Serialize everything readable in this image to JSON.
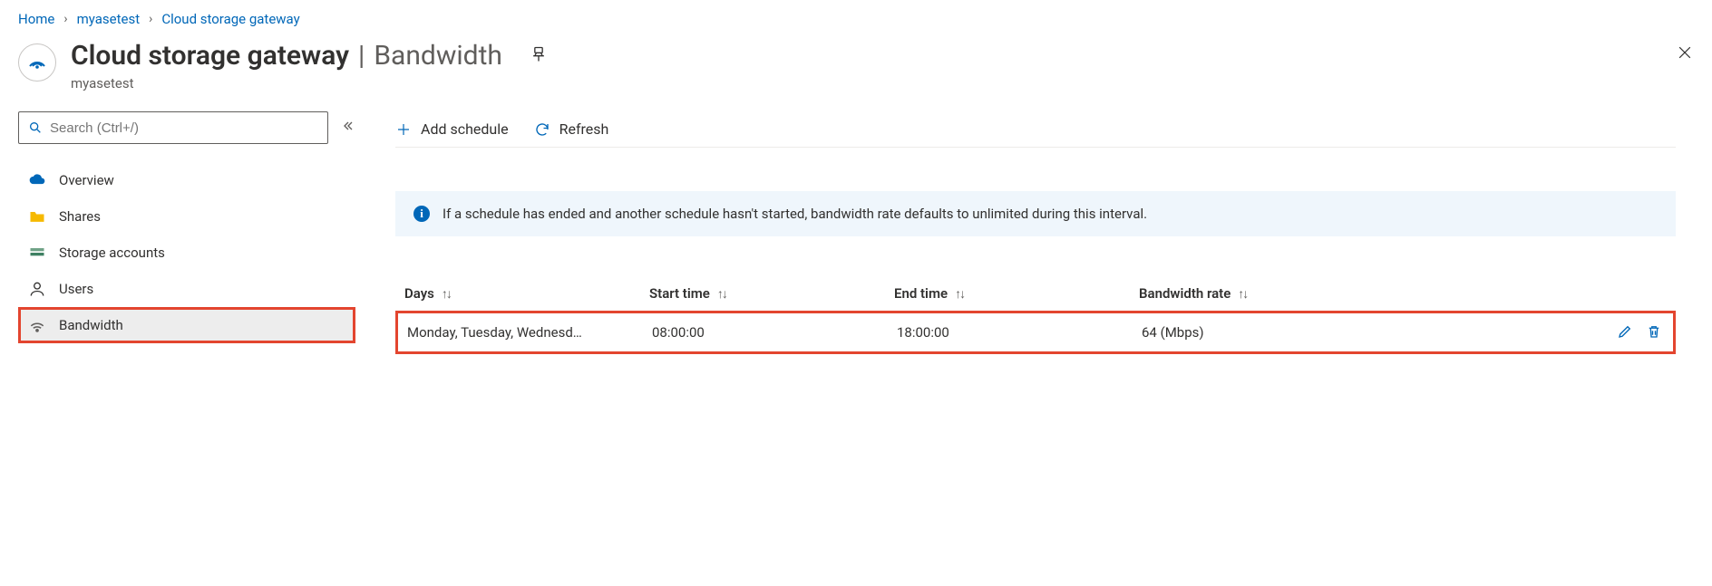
{
  "breadcrumb": {
    "home": "Home",
    "resource": "myasetest",
    "page": "Cloud storage gateway"
  },
  "header": {
    "title": "Cloud storage gateway",
    "section": "Bandwidth",
    "subtitle": "myasetest"
  },
  "search": {
    "placeholder": "Search (Ctrl+/)"
  },
  "sidebar": {
    "items": [
      {
        "label": "Overview"
      },
      {
        "label": "Shares"
      },
      {
        "label": "Storage accounts"
      },
      {
        "label": "Users"
      },
      {
        "label": "Bandwidth"
      }
    ]
  },
  "toolbar": {
    "add": "Add schedule",
    "refresh": "Refresh"
  },
  "info": {
    "text": "If a schedule has ended and another schedule hasn't started, bandwidth rate defaults to unlimited during this interval."
  },
  "table": {
    "columns": {
      "days": "Days",
      "start": "Start time",
      "end": "End time",
      "rate": "Bandwidth rate"
    },
    "rows": [
      {
        "days": "Monday, Tuesday, Wednesd…",
        "start": "08:00:00",
        "end": "18:00:00",
        "rate": "64 (Mbps)"
      }
    ]
  }
}
